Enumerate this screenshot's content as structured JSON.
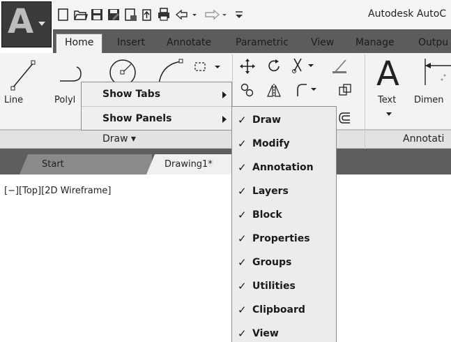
{
  "window": {
    "title": "Autodesk AutoC"
  },
  "app_button": {
    "glyph": "A"
  },
  "quick_access": [
    "new-file-icon",
    "open-folder-icon",
    "save-icon",
    "save-as-icon",
    "export-icon",
    "share-icon",
    "print-icon",
    "undo-icon",
    "redo-icon",
    "customize-icon"
  ],
  "ribbon_tabs": [
    "Home",
    "Insert",
    "Annotate",
    "Parametric",
    "View",
    "Manage",
    "Outpu"
  ],
  "active_tab": "Home",
  "draw_panel": {
    "tools": {
      "line": "Line",
      "polyline": "Polyl"
    },
    "footer": "Draw ▾"
  },
  "annotation_panel": {
    "tools": {
      "text": "Text",
      "dimension": "Dimen"
    },
    "text_glyph": "A",
    "footer": "Annotati"
  },
  "doc_tabs": [
    "Start",
    "Drawing1*"
  ],
  "viewport_label": "[−][Top][2D Wireframe]",
  "context_menu": {
    "items": [
      {
        "label": "Show Tabs",
        "submenu": true
      },
      {
        "label": "Show Panels",
        "submenu": true
      }
    ]
  },
  "submenu": {
    "check_glyph": "✓",
    "items": [
      "Draw",
      "Modify",
      "Annotation",
      "Layers",
      "Block",
      "Properties",
      "Groups",
      "Utilities",
      "Clipboard",
      "View"
    ]
  },
  "colors": {
    "app_button": "#3a3a3a",
    "tab_row": "#5c5c5c",
    "ribbon_body": "#f3f3f3",
    "menu_bg": "#efefef"
  }
}
